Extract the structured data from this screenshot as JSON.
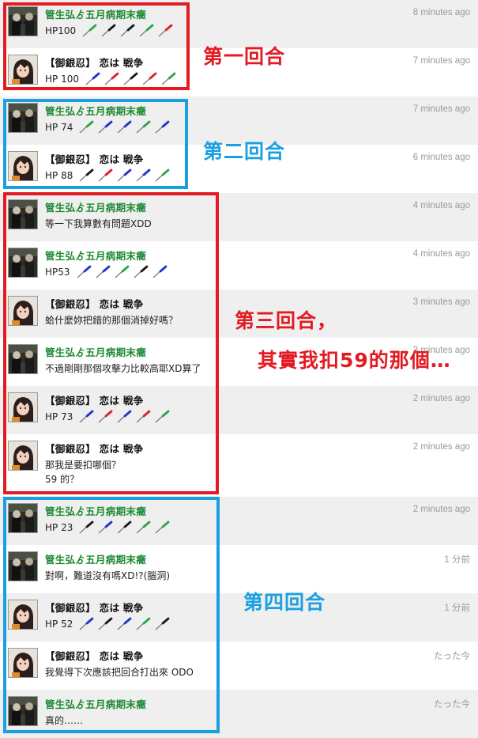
{
  "colors": {
    "red_box": "#e31a22",
    "blue_box": "#1a9fe0",
    "name_green": "#1b8a2f"
  },
  "posts": [
    {
      "user": "管生弘ゟ五月病期末癥",
      "name_color": "green",
      "avatar": "a",
      "time": "8 minutes ago",
      "hp": "HP100",
      "pins": [
        "green",
        "black",
        "black",
        "green",
        "red"
      ]
    },
    {
      "user": "【御銀忍】 恋は 戦争",
      "name_color": "black",
      "avatar": "b",
      "time": "7 minutes ago",
      "hp": "HP 100",
      "pins": [
        "blue",
        "red",
        "black",
        "red",
        "green"
      ]
    },
    {
      "user": "管生弘ゟ五月病期末癥",
      "name_color": "green",
      "avatar": "a",
      "time": "7 minutes ago",
      "hp": "HP 74",
      "pins": [
        "green",
        "blue",
        "blue",
        "green",
        "blue"
      ]
    },
    {
      "user": "【御銀忍】 恋は 戦争",
      "name_color": "black",
      "avatar": "b",
      "time": "6 minutes ago",
      "hp": "HP 88",
      "pins": [
        "black",
        "red",
        "blue",
        "blue",
        "green"
      ]
    },
    {
      "user": "管生弘ゟ五月病期末癥",
      "name_color": "green",
      "avatar": "a",
      "time": "4 minutes ago",
      "text": [
        "等一下我算數有問題XDD"
      ]
    },
    {
      "user": "管生弘ゟ五月病期末癥",
      "name_color": "green",
      "avatar": "a",
      "time": "4 minutes ago",
      "hp": "HP53",
      "pins": [
        "blue",
        "blue",
        "green",
        "black",
        "blue"
      ]
    },
    {
      "user": "【御銀忍】 恋は 戦争",
      "name_color": "black",
      "avatar": "b",
      "time": "3 minutes ago",
      "text": [
        "蛤什麼妳把錯的那個消掉好嗎？"
      ]
    },
    {
      "user": "管生弘ゟ五月病期末癥",
      "name_color": "green",
      "avatar": "a",
      "time": "3 minutes ago",
      "text": [
        "不過剛剛那個攻擊力比較高耶XD算了"
      ]
    },
    {
      "user": "【御銀忍】 恋は 戦争",
      "name_color": "black",
      "avatar": "b",
      "time": "2 minutes ago",
      "hp": "HP 73",
      "pins": [
        "blue",
        "red",
        "blue",
        "red",
        "green"
      ]
    },
    {
      "user": "【御銀忍】 恋は 戦争",
      "name_color": "black",
      "avatar": "b",
      "time": "2 minutes ago",
      "text": [
        "那我是要扣哪個？",
        "59 的？"
      ]
    },
    {
      "user": "管生弘ゟ五月病期末癥",
      "name_color": "green",
      "avatar": "a",
      "time": "2 minutes ago",
      "hp": "HP 23",
      "pins": [
        "black",
        "blue",
        "black",
        "green",
        "green"
      ]
    },
    {
      "user": "管生弘ゟ五月病期末癥",
      "name_color": "green",
      "avatar": "a",
      "time": "1 分前",
      "text": [
        "對啊，難道沒有嗎XD!?(腦洞)"
      ]
    },
    {
      "user": "【御銀忍】 恋は 戦争",
      "name_color": "black",
      "avatar": "b",
      "time": "1 分前",
      "hp": "HP 52",
      "pins": [
        "blue",
        "black",
        "blue",
        "green",
        "black"
      ]
    },
    {
      "user": "【御銀忍】 恋は 戦争",
      "name_color": "black",
      "avatar": "b",
      "time": "たった今",
      "text": [
        "我覺得下次應該把回合打出來 ODO"
      ]
    },
    {
      "user": "管生弘ゟ五月病期末癥",
      "name_color": "green",
      "avatar": "a",
      "time": "たった今",
      "text": [
        "真的……"
      ]
    }
  ],
  "annotations": {
    "round1": "第一回合",
    "round2": "第二回合",
    "round3_line1": "第三回合，",
    "round3_line2": "其實我扣59的那個…",
    "round4": "第四回合"
  }
}
